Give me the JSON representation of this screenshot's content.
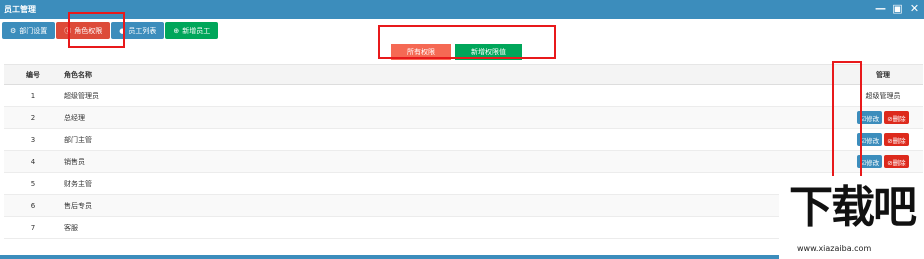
{
  "window": {
    "title": "员工管理",
    "controls": [
      "—",
      "▣",
      "✕"
    ]
  },
  "tabs": [
    {
      "label": "部门设置",
      "icon": "⚙",
      "icon_name": "sitemap-icon",
      "color": "#3c8dbc"
    },
    {
      "label": "角色权限",
      "icon": "ⓘ",
      "icon_name": "info-circle-icon",
      "color": "#dd4b39"
    },
    {
      "label": "员工列表",
      "icon": "●",
      "icon_name": "user-icon",
      "color": "#3c8dbc"
    },
    {
      "label": "新增员工",
      "icon": "⊕",
      "icon_name": "plus-circle-icon",
      "color": "#00a65a"
    }
  ],
  "actions": {
    "all_permissions": "所有权限",
    "add_permission_value": "新增权限值"
  },
  "table": {
    "headers": {
      "num": "编号",
      "name": "角色名称",
      "manage": "管理"
    },
    "edit_label": "☑修改",
    "delete_label": "⊘删除",
    "rows": [
      {
        "num": "1",
        "name": "超级管理员",
        "manage_text": "超级管理员"
      },
      {
        "num": "2",
        "name": "总经理"
      },
      {
        "num": "3",
        "name": "部门主管"
      },
      {
        "num": "4",
        "name": "销售员"
      },
      {
        "num": "5",
        "name": "财务主管"
      },
      {
        "num": "6",
        "name": "售后专员"
      },
      {
        "num": "7",
        "name": "客服"
      }
    ]
  },
  "watermark": {
    "logo_text": "下载吧",
    "url": "www.xiazaiba.com"
  }
}
